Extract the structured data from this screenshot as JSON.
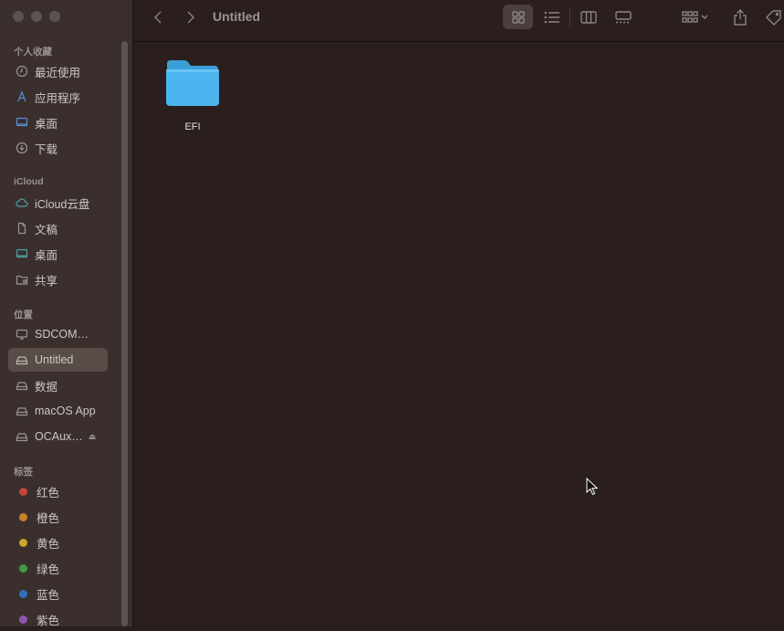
{
  "window": {
    "title": "Untitled"
  },
  "sidebar": {
    "favorites_title": "个人收藏",
    "favorites": [
      {
        "label": "最近使用",
        "icon": "clock-icon"
      },
      {
        "label": "应用程序",
        "icon": "apps-icon"
      },
      {
        "label": "桌面",
        "icon": "desktop-icon"
      },
      {
        "label": "下载",
        "icon": "download-icon"
      }
    ],
    "icloud_title": "iCloud",
    "icloud": [
      {
        "label": "iCloud云盘",
        "icon": "cloud-icon"
      },
      {
        "label": "文稿",
        "icon": "document-icon"
      },
      {
        "label": "桌面",
        "icon": "desktop-icon"
      },
      {
        "label": "共享",
        "icon": "shared-folder-icon"
      }
    ],
    "locations_title": "位置",
    "locations": [
      {
        "label": "SDCOM…",
        "icon": "computer-icon"
      },
      {
        "label": "Untitled",
        "icon": "disk-icon",
        "selected": true
      },
      {
        "label": "数据",
        "icon": "disk-icon"
      },
      {
        "label": "macOS App",
        "icon": "disk-icon"
      },
      {
        "label": "OCAux…",
        "icon": "disk-icon",
        "eject": "⏏"
      }
    ],
    "tags_title": "标签",
    "tags": [
      {
        "label": "红色",
        "color": "#c0463b"
      },
      {
        "label": "橙色",
        "color": "#c7812a"
      },
      {
        "label": "黄色",
        "color": "#c8a82c"
      },
      {
        "label": "绿色",
        "color": "#3f9a48"
      },
      {
        "label": "蓝色",
        "color": "#2f6fbf"
      },
      {
        "label": "紫色",
        "color": "#8e55b4"
      }
    ]
  },
  "content": {
    "items": [
      {
        "name": "EFI",
        "type": "folder"
      }
    ]
  },
  "colors": {
    "folder": "#3aa8ea",
    "background": "#2a1f1d",
    "sidebar": "#3a2f2c"
  }
}
